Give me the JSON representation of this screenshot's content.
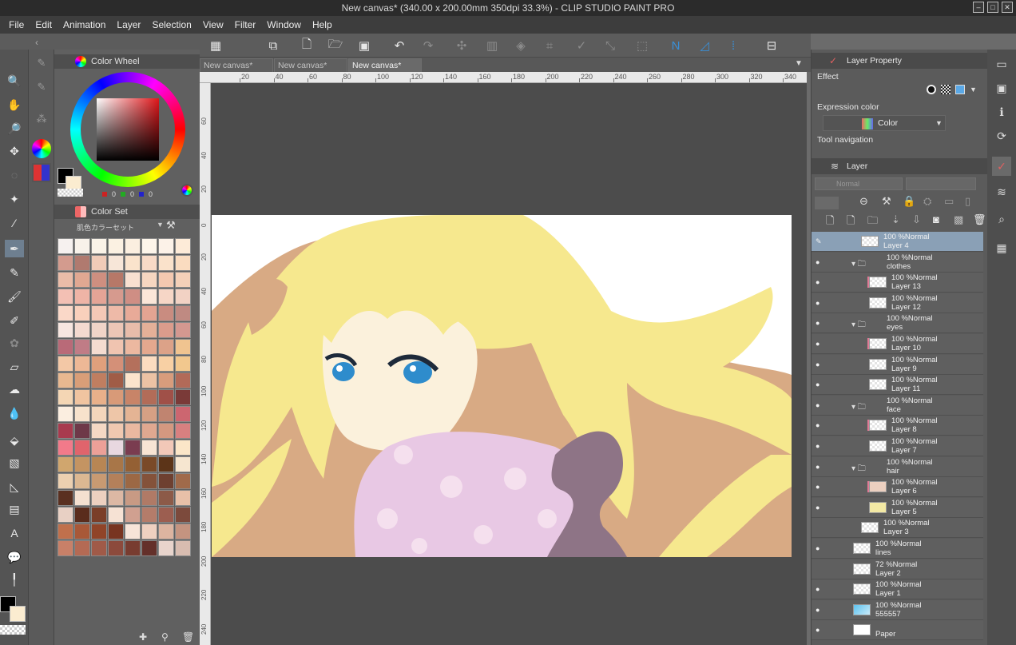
{
  "window": {
    "title": "New canvas* (340.00 x 200.00mm 350dpi 33.3%)  - CLIP STUDIO PAINT PRO"
  },
  "menu": [
    "File",
    "Edit",
    "Animation",
    "Layer",
    "Selection",
    "View",
    "Filter",
    "Window",
    "Help"
  ],
  "tabs": [
    "New canvas*",
    "New canvas*",
    "New canvas*"
  ],
  "ruler": {
    "top_ticks": [
      "20",
      "40",
      "60",
      "80",
      "100",
      "120",
      "140",
      "160",
      "180",
      "200",
      "220",
      "240",
      "260",
      "280",
      "300",
      "320",
      "340"
    ],
    "left_ticks": [
      "60",
      "40",
      "20",
      "0",
      "20",
      "40",
      "60",
      "80",
      "100",
      "120",
      "140",
      "160",
      "180",
      "200",
      "220",
      "240"
    ]
  },
  "color_wheel": {
    "title": "Color Wheel",
    "values": [
      "0",
      "0",
      "0"
    ],
    "main_color": "#000000",
    "sub_color": "#fbecd0"
  },
  "color_set": {
    "title": "Color Set",
    "set_name": "肌色カラーセット",
    "swatches": [
      [
        "#f6f1ef",
        "#f8f2ea",
        "#faf3e8",
        "#fbf1e2",
        "#fbefe0",
        "#fdf5ea",
        "#fcf2e8",
        "#fdebd8"
      ],
      [
        "#d39b8e",
        "#b07a6f",
        "#f0cbb8",
        "#f7e6d8",
        "#fae3cc",
        "#f8dac7",
        "#fae2cb",
        "#fadcc0"
      ],
      [
        "#eabca8",
        "#e0a892",
        "#cf8f80",
        "#b67868",
        "#f8e0d0",
        "#f6d6c0",
        "#f3c8b0",
        "#f4d0b8"
      ],
      [
        "#f3c0b4",
        "#efb4a6",
        "#e4a496",
        "#d69a8e",
        "#cf8e84",
        "#fbe6d8",
        "#f6d6c6",
        "#f2d2c4"
      ],
      [
        "#fad8c8",
        "#f9d0bc",
        "#f4c8b6",
        "#eebaa8",
        "#e8aa98",
        "#e4a492",
        "#c98c80",
        "#bf8a82"
      ],
      [
        "#f7e6e0",
        "#f4dad0",
        "#f0d4c8",
        "#ecc6b6",
        "#e8bcaa",
        "#e4b098",
        "#db9c8c",
        "#d49890"
      ],
      [
        "#b96a78",
        "#c07c86",
        "#f4dcd0",
        "#f0c4b0",
        "#ecb8a0",
        "#e4a88e",
        "#dca288",
        "#f0c490"
      ],
      [
        "#f3c8a6",
        "#edb896",
        "#e0a07c",
        "#d49078",
        "#b4705c",
        "#fbdcc0",
        "#f8d0a4",
        "#f2c88e"
      ],
      [
        "#e8b890",
        "#d99e78",
        "#c07e60",
        "#a05c46",
        "#fbe4cc",
        "#ecc2a4",
        "#d89c7c",
        "#b26a58"
      ],
      [
        "#f4d6b4",
        "#f0c4a0",
        "#e8b08a",
        "#d89a78",
        "#c88468",
        "#b26c58",
        "#a05048",
        "#7a3a38"
      ],
      [
        "#fbeee0",
        "#f7e2cc",
        "#f3d6bc",
        "#eec6a8",
        "#e4b494",
        "#d6a084",
        "#c08470",
        "#cc6670"
      ],
      [
        "#a83a4e",
        "#6e3848",
        "#f4d8c4",
        "#f0c8b0",
        "#eab8a0",
        "#e0a890",
        "#d49880",
        "#d88080"
      ],
      [
        "#f27a8a",
        "#e0646c",
        "#eca098",
        "#e8d8e0",
        "#7a3c50",
        "#f7e4d4",
        "#f2c8b8",
        "#fbe6c8"
      ],
      [
        "#d0a66e",
        "#c49462",
        "#b88654",
        "#a87648",
        "#946034",
        "#7a4a28",
        "#5c3418",
        "#f6e6d0"
      ],
      [
        "#ecd0b0",
        "#dcb892",
        "#c89a72",
        "#b4805a",
        "#9c6844",
        "#84523a",
        "#6e4030",
        "#a06a4a"
      ],
      [
        "#5a3020",
        "#f4e0d0",
        "#ecd0c0",
        "#dcb8a4",
        "#c89a84",
        "#b07a66",
        "#8c5a48",
        "#e8c0a8"
      ],
      [
        "#e8d0c4",
        "#5a2c1c",
        "#7a3e28",
        "#f6e2d4",
        "#d0a090",
        "#b47c6a",
        "#9c5e50",
        "#7c4a3c"
      ],
      [
        "#c0704c",
        "#a85838",
        "#904428",
        "#783420",
        "#f7e4d8",
        "#eed0c0",
        "#dcb4a0",
        "#c49480"
      ],
      [
        "#c88068",
        "#b46a54",
        "#a05a48",
        "#8c4a3c",
        "#783c30",
        "#64302a",
        "#e8d4cc",
        "#d8bcb0"
      ]
    ]
  },
  "right_panel": {
    "layer_property_title": "Layer Property",
    "effect_label": "Effect",
    "expression_color_label": "Expression color",
    "expression_color_value": "Color",
    "tool_navigation_label": "Tool navigation",
    "layer_title": "Layer",
    "blend_mode": "Normal"
  },
  "layers": [
    {
      "opacity": "100 %Normal",
      "name": "Layer 4",
      "selected": true,
      "folder": false,
      "indent": 1,
      "mark": false
    },
    {
      "opacity": "100 %Normal",
      "name": "clothes",
      "selected": false,
      "folder": true,
      "indent": 1,
      "mark": false
    },
    {
      "opacity": "100 %Normal",
      "name": "Layer 13",
      "selected": false,
      "folder": false,
      "indent": 2,
      "mark": true
    },
    {
      "opacity": "100 %Normal",
      "name": "Layer 12",
      "selected": false,
      "folder": false,
      "indent": 2,
      "mark": false
    },
    {
      "opacity": "100 %Normal",
      "name": "eyes",
      "selected": false,
      "folder": true,
      "indent": 1,
      "mark": false
    },
    {
      "opacity": "100 %Normal",
      "name": "Layer 10",
      "selected": false,
      "folder": false,
      "indent": 2,
      "mark": true
    },
    {
      "opacity": "100 %Normal",
      "name": "Layer 9",
      "selected": false,
      "folder": false,
      "indent": 2,
      "mark": false
    },
    {
      "opacity": "100 %Normal",
      "name": "Layer 11",
      "selected": false,
      "folder": false,
      "indent": 2,
      "mark": false
    },
    {
      "opacity": "100 %Normal",
      "name": "face",
      "selected": false,
      "folder": true,
      "indent": 1,
      "mark": false
    },
    {
      "opacity": "100 %Normal",
      "name": "Layer 8",
      "selected": false,
      "folder": false,
      "indent": 2,
      "mark": true
    },
    {
      "opacity": "100 %Normal",
      "name": "Layer 7",
      "selected": false,
      "folder": false,
      "indent": 2,
      "mark": false
    },
    {
      "opacity": "100 %Normal",
      "name": "hair",
      "selected": false,
      "folder": true,
      "indent": 1,
      "mark": false
    },
    {
      "opacity": "100 %Normal",
      "name": "Layer 6",
      "selected": false,
      "folder": false,
      "indent": 2,
      "mark": true
    },
    {
      "opacity": "100 %Normal",
      "name": "Layer 5",
      "selected": false,
      "folder": false,
      "indent": 2,
      "mark": false
    },
    {
      "opacity": "100 %Normal",
      "name": "Layer 3",
      "selected": false,
      "folder": false,
      "indent": 1,
      "mark": false
    },
    {
      "opacity": "100 %Normal",
      "name": "lines",
      "selected": false,
      "folder": false,
      "indent": 0,
      "mark": false
    },
    {
      "opacity": "72 %Normal",
      "name": "Layer 2",
      "selected": false,
      "folder": false,
      "indent": 0,
      "mark": false
    },
    {
      "opacity": "100 %Normal",
      "name": "Layer 1",
      "selected": false,
      "folder": false,
      "indent": 0,
      "mark": false
    },
    {
      "opacity": "100 %Normal",
      "name": "555557",
      "selected": false,
      "folder": false,
      "indent": 0,
      "mark": false
    },
    {
      "opacity": "",
      "name": "Paper",
      "selected": false,
      "folder": false,
      "indent": 0,
      "mark": false
    }
  ],
  "colors": {
    "hair": "#f6e88e",
    "hair_shadow": "#d8aa84",
    "skin": "#fbf1dc",
    "clothes": "#e8c8e4",
    "sleeve": "#8e7486",
    "eye": "#2e8ccc"
  }
}
